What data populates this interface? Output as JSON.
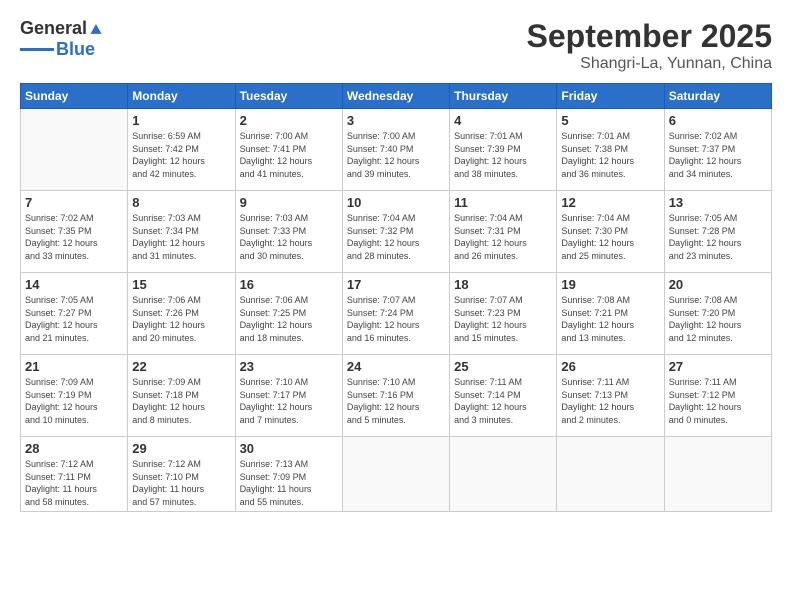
{
  "header": {
    "logo_general": "General",
    "logo_blue": "Blue",
    "month": "September 2025",
    "location": "Shangri-La, Yunnan, China"
  },
  "days_of_week": [
    "Sunday",
    "Monday",
    "Tuesday",
    "Wednesday",
    "Thursday",
    "Friday",
    "Saturday"
  ],
  "weeks": [
    [
      {
        "day": "",
        "info": ""
      },
      {
        "day": "1",
        "info": "Sunrise: 6:59 AM\nSunset: 7:42 PM\nDaylight: 12 hours\nand 42 minutes."
      },
      {
        "day": "2",
        "info": "Sunrise: 7:00 AM\nSunset: 7:41 PM\nDaylight: 12 hours\nand 41 minutes."
      },
      {
        "day": "3",
        "info": "Sunrise: 7:00 AM\nSunset: 7:40 PM\nDaylight: 12 hours\nand 39 minutes."
      },
      {
        "day": "4",
        "info": "Sunrise: 7:01 AM\nSunset: 7:39 PM\nDaylight: 12 hours\nand 38 minutes."
      },
      {
        "day": "5",
        "info": "Sunrise: 7:01 AM\nSunset: 7:38 PM\nDaylight: 12 hours\nand 36 minutes."
      },
      {
        "day": "6",
        "info": "Sunrise: 7:02 AM\nSunset: 7:37 PM\nDaylight: 12 hours\nand 34 minutes."
      }
    ],
    [
      {
        "day": "7",
        "info": "Sunrise: 7:02 AM\nSunset: 7:35 PM\nDaylight: 12 hours\nand 33 minutes."
      },
      {
        "day": "8",
        "info": "Sunrise: 7:03 AM\nSunset: 7:34 PM\nDaylight: 12 hours\nand 31 minutes."
      },
      {
        "day": "9",
        "info": "Sunrise: 7:03 AM\nSunset: 7:33 PM\nDaylight: 12 hours\nand 30 minutes."
      },
      {
        "day": "10",
        "info": "Sunrise: 7:04 AM\nSunset: 7:32 PM\nDaylight: 12 hours\nand 28 minutes."
      },
      {
        "day": "11",
        "info": "Sunrise: 7:04 AM\nSunset: 7:31 PM\nDaylight: 12 hours\nand 26 minutes."
      },
      {
        "day": "12",
        "info": "Sunrise: 7:04 AM\nSunset: 7:30 PM\nDaylight: 12 hours\nand 25 minutes."
      },
      {
        "day": "13",
        "info": "Sunrise: 7:05 AM\nSunset: 7:28 PM\nDaylight: 12 hours\nand 23 minutes."
      }
    ],
    [
      {
        "day": "14",
        "info": "Sunrise: 7:05 AM\nSunset: 7:27 PM\nDaylight: 12 hours\nand 21 minutes."
      },
      {
        "day": "15",
        "info": "Sunrise: 7:06 AM\nSunset: 7:26 PM\nDaylight: 12 hours\nand 20 minutes."
      },
      {
        "day": "16",
        "info": "Sunrise: 7:06 AM\nSunset: 7:25 PM\nDaylight: 12 hours\nand 18 minutes."
      },
      {
        "day": "17",
        "info": "Sunrise: 7:07 AM\nSunset: 7:24 PM\nDaylight: 12 hours\nand 16 minutes."
      },
      {
        "day": "18",
        "info": "Sunrise: 7:07 AM\nSunset: 7:23 PM\nDaylight: 12 hours\nand 15 minutes."
      },
      {
        "day": "19",
        "info": "Sunrise: 7:08 AM\nSunset: 7:21 PM\nDaylight: 12 hours\nand 13 minutes."
      },
      {
        "day": "20",
        "info": "Sunrise: 7:08 AM\nSunset: 7:20 PM\nDaylight: 12 hours\nand 12 minutes."
      }
    ],
    [
      {
        "day": "21",
        "info": "Sunrise: 7:09 AM\nSunset: 7:19 PM\nDaylight: 12 hours\nand 10 minutes."
      },
      {
        "day": "22",
        "info": "Sunrise: 7:09 AM\nSunset: 7:18 PM\nDaylight: 12 hours\nand 8 minutes."
      },
      {
        "day": "23",
        "info": "Sunrise: 7:10 AM\nSunset: 7:17 PM\nDaylight: 12 hours\nand 7 minutes."
      },
      {
        "day": "24",
        "info": "Sunrise: 7:10 AM\nSunset: 7:16 PM\nDaylight: 12 hours\nand 5 minutes."
      },
      {
        "day": "25",
        "info": "Sunrise: 7:11 AM\nSunset: 7:14 PM\nDaylight: 12 hours\nand 3 minutes."
      },
      {
        "day": "26",
        "info": "Sunrise: 7:11 AM\nSunset: 7:13 PM\nDaylight: 12 hours\nand 2 minutes."
      },
      {
        "day": "27",
        "info": "Sunrise: 7:11 AM\nSunset: 7:12 PM\nDaylight: 12 hours\nand 0 minutes."
      }
    ],
    [
      {
        "day": "28",
        "info": "Sunrise: 7:12 AM\nSunset: 7:11 PM\nDaylight: 11 hours\nand 58 minutes."
      },
      {
        "day": "29",
        "info": "Sunrise: 7:12 AM\nSunset: 7:10 PM\nDaylight: 11 hours\nand 57 minutes."
      },
      {
        "day": "30",
        "info": "Sunrise: 7:13 AM\nSunset: 7:09 PM\nDaylight: 11 hours\nand 55 minutes."
      },
      {
        "day": "",
        "info": ""
      },
      {
        "day": "",
        "info": ""
      },
      {
        "day": "",
        "info": ""
      },
      {
        "day": "",
        "info": ""
      }
    ]
  ]
}
